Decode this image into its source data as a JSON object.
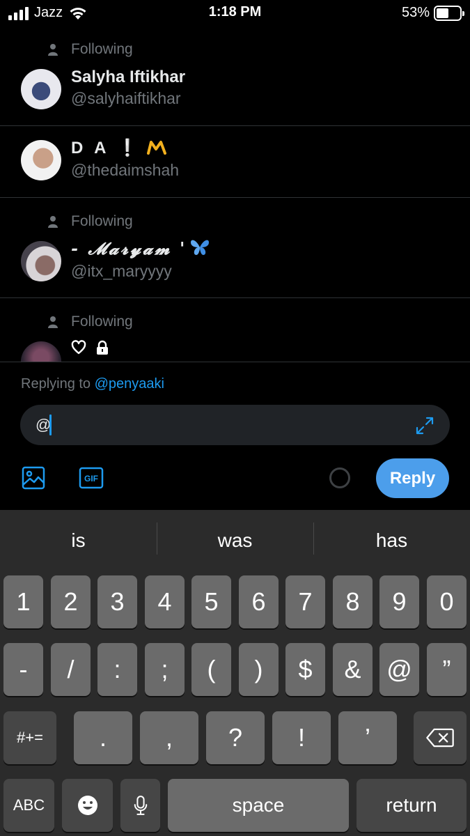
{
  "status": {
    "carrier": "Jazz",
    "time": "1:18 PM",
    "battery": "53%",
    "battery_level": 0.53
  },
  "rows": [
    {
      "context": "Following",
      "name": "Salyha Iftikhar",
      "handle": "@salyhaiftikhar"
    },
    {
      "context": "",
      "name": "D A ❕",
      "handle": "@thedaimshah"
    },
    {
      "context": "Following",
      "name": "- 𝓜𝓪𝓻𝔂𝓪𝓶 '",
      "handle": "@itx_maryyyy"
    },
    {
      "context": "Following",
      "name": "",
      "handle": ""
    }
  ],
  "compose": {
    "replying_prefix": "Replying to",
    "replying_mention": "@penyaaki",
    "input_value": "@",
    "reply_label": "Reply",
    "gif_label": "GIF"
  },
  "keyboard": {
    "suggestions": [
      "is",
      "was",
      "has"
    ],
    "row1": [
      "1",
      "2",
      "3",
      "4",
      "5",
      "6",
      "7",
      "8",
      "9",
      "0"
    ],
    "row2": [
      "-",
      "/",
      ":",
      ";",
      "(",
      ")",
      "$",
      "&",
      "@",
      "”"
    ],
    "row3": [
      ".",
      ",",
      "?",
      "!",
      "’"
    ],
    "symbols_key": "#+=",
    "abc_key": "ABC",
    "space_key": "space",
    "return_key": "return"
  },
  "colors": {
    "accent": "#1d9bf0",
    "reply_button": "#4c9eeb",
    "muted_text": "#71767b",
    "keyboard_bg": "#2b2b2b",
    "key_bg": "#6b6b6b",
    "key_dark_bg": "#464646"
  }
}
